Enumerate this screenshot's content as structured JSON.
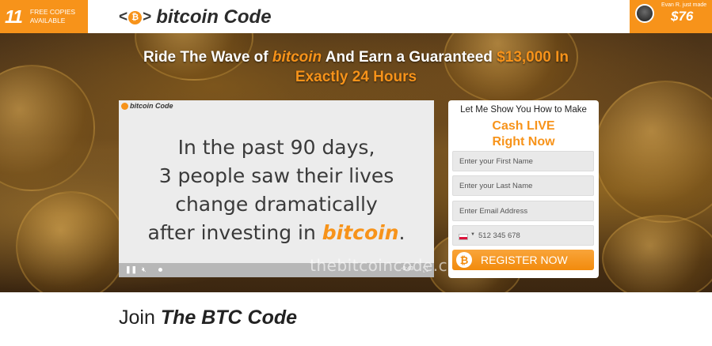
{
  "header": {
    "copies_count": "11",
    "copies_text_line1": "FREE COPIES",
    "copies_text_line2": "AVAILABLE",
    "brand_mark_left": "<",
    "brand_mark_coin": "₿",
    "brand_mark_right": ">",
    "brand_name": "bitcoin Code",
    "winner_text": "Evan R. just made",
    "winner_amount": "$76"
  },
  "hero": {
    "headline_part1": "Ride The Wave of ",
    "headline_bitcoin": "bitcoin",
    "headline_part2": " And Earn a Guaranteed ",
    "headline_amount": "$13,000 In",
    "headline_line2": "Exactly 24 Hours"
  },
  "video": {
    "brand": "bitcoin Code",
    "line1": "In the past 90 days,",
    "line2": "3 people saw their lives",
    "line3": "change dramatically",
    "line4_prefix": "after investing in ",
    "line4_bitcoin": "bitcoin",
    "line4_suffix": ".",
    "time": "-0:43",
    "watermark": "thebitcoincode.com"
  },
  "form": {
    "intro": "Let Me Show You How to Make",
    "cash_line1": "Cash LIVE",
    "cash_line2": "Right Now",
    "first_name_placeholder": "Enter your First Name",
    "last_name_placeholder": "Enter your Last Name",
    "email_placeholder": "Enter Email Address",
    "phone_placeholder": "512 345 678",
    "register_label": "REGISTER NOW",
    "register_icon": "₿"
  },
  "footer": {
    "join_prefix": "Join ",
    "join_title": "The BTC Code"
  },
  "colors": {
    "accent": "#f7931a",
    "video_bg": "#ececec"
  }
}
